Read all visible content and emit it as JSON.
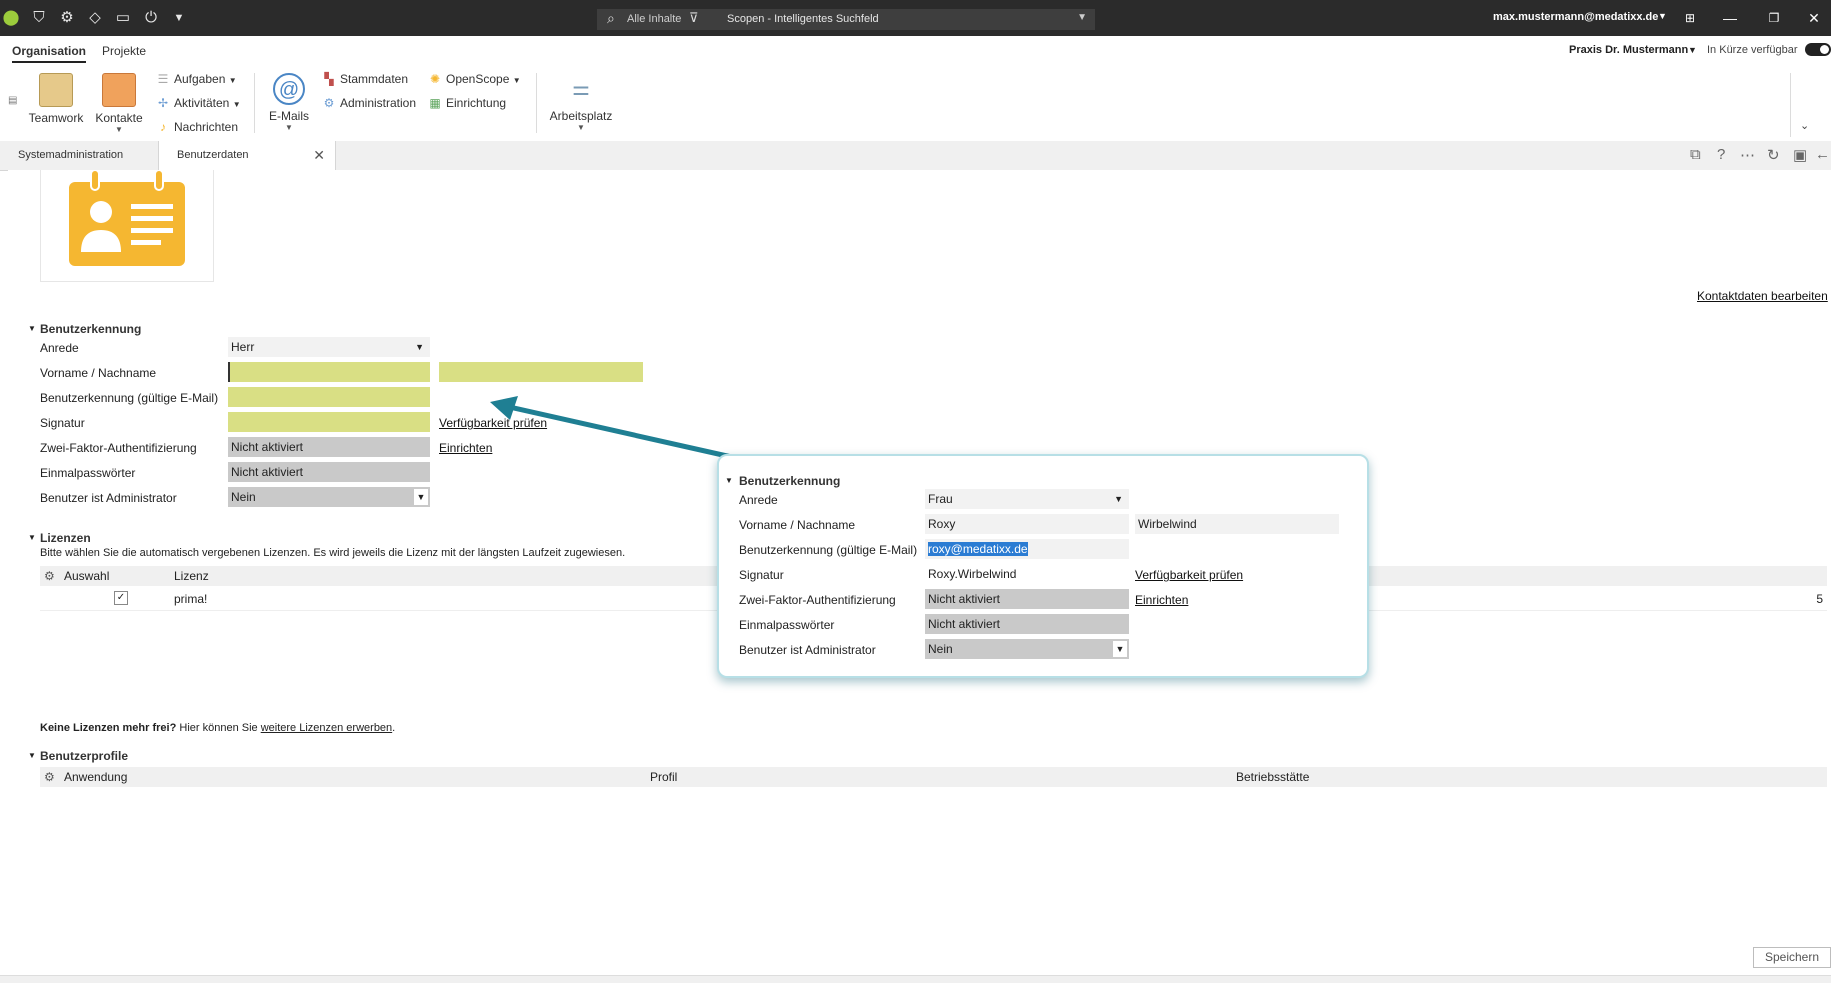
{
  "titlebar": {
    "search_scope": "Alle Inhalte",
    "search_text": "Scopen - Intelligentes Suchfeld",
    "user_email": "max.mustermann@medatixx.de"
  },
  "menubar": {
    "tabs": [
      "Organisation",
      "Projekte"
    ],
    "praxis": "Praxis Dr. Mustermann",
    "availability": "In Kürze verfügbar"
  },
  "ribbon": {
    "teamwork": "Teamwork",
    "kontakte": "Kontakte",
    "aufgaben": "Aufgaben",
    "aktivitaeten": "Aktivitäten",
    "nachrichten": "Nachrichten",
    "emails": "E-Mails",
    "stammdaten": "Stammdaten",
    "administration": "Administration",
    "openscope": "OpenScope",
    "einrichtung": "Einrichtung",
    "arbeitsplatz": "Arbeitsplatz"
  },
  "doctabs": {
    "systemadmin": "Systemadministration",
    "benutzerdaten": "Benutzerdaten"
  },
  "content": {
    "kontakt_link": "Kontaktdaten bearbeiten",
    "benutzerkennung": {
      "title": "Benutzerkennung",
      "anrede_label": "Anrede",
      "anrede_value": "Herr",
      "name_label": "Vorname / Nachname",
      "vorname_value": "",
      "nachname_value": "",
      "email_label": "Benutzerkennung (gültige E-Mail)",
      "email_value": "",
      "signatur_label": "Signatur",
      "signatur_value": "",
      "verfuegbarkeit_link": "Verfügbarkeit prüfen",
      "zwei_faktor_label": "Zwei-Faktor-Authentifizierung",
      "zwei_faktor_value": "Nicht aktiviert",
      "einrichten_link": "Einrichten",
      "einmal_label": "Einmalpasswörter",
      "einmal_value": "Nicht aktiviert",
      "admin_label": "Benutzer ist Administrator",
      "admin_value": "Nein"
    },
    "lizenzen": {
      "title": "Lizenzen",
      "hint": "Bitte wählen Sie die automatisch vergebenen Lizenzen. Es wird jeweils die Lizenz mit der längsten Laufzeit zugewiesen.",
      "col_auswahl": "Auswahl",
      "col_lizenz": "Lizenz",
      "row_lizenz": "prima!",
      "row_count": "5",
      "more_bold": "Keine Lizenzen mehr frei?",
      "more_text": " Hier können Sie ",
      "more_link": "weitere Lizenzen erwerben",
      "more_end": "."
    },
    "profile": {
      "title": "Benutzerprofile",
      "col_anwendung": "Anwendung",
      "col_profil": "Profil",
      "col_betrieb": "Betriebsstätte"
    },
    "save_label": "Speichern"
  },
  "popup": {
    "title": "Benutzerkennung",
    "anrede_label": "Anrede",
    "anrede_value": "Frau",
    "name_label": "Vorname / Nachname",
    "vorname_value": "Roxy",
    "nachname_value": "Wirbelwind",
    "email_label": "Benutzerkennung (gültige E-Mail)",
    "email_value": "roxy@medatixx.de",
    "signatur_label": "Signatur",
    "signatur_value": "Roxy.Wirbelwind",
    "verfuegbarkeit_link": "Verfügbarkeit prüfen",
    "zwei_faktor_label": "Zwei-Faktor-Authentifizierung",
    "zwei_faktor_value": "Nicht aktiviert",
    "einrichten_link": "Einrichten",
    "einmal_label": "Einmalpasswörter",
    "einmal_value": "Nicht aktiviert",
    "admin_label": "Benutzer ist Administrator",
    "admin_value": "Nein"
  },
  "colors": {
    "required_field": "#d9df84",
    "readonly_field": "#c9c9c9",
    "arrow": "#1f7f93",
    "badge": "#f5b731"
  }
}
